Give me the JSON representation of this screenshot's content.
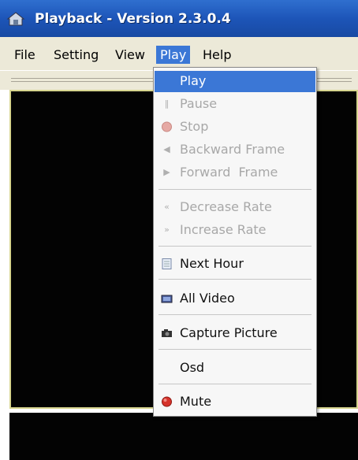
{
  "window": {
    "title": "Playback - Version 2.3.0.4",
    "icon": "app-house-icon"
  },
  "menubar": [
    "File",
    "Setting",
    "View",
    "Play",
    "Help"
  ],
  "play_menu": {
    "items": [
      {
        "label": "Play",
        "state": "highlighted",
        "icon": "none"
      },
      {
        "label": "Pause",
        "state": "disabled",
        "icon": "pause-icon"
      },
      {
        "label": "Stop",
        "state": "disabled",
        "icon": "stop-icon"
      },
      {
        "label": "Backward Frame",
        "state": "disabled",
        "icon": "backward-frame-icon"
      },
      {
        "label": "Forward  Frame",
        "state": "disabled",
        "icon": "forward-frame-icon"
      },
      {
        "label": "Decrease Rate",
        "state": "disabled",
        "icon": "decrease-rate-icon"
      },
      {
        "label": "Increase Rate",
        "state": "disabled",
        "icon": "increase-rate-icon"
      },
      {
        "label": "Next Hour",
        "state": "enabled",
        "icon": "document-icon"
      },
      {
        "label": "All Video",
        "state": "enabled",
        "icon": "video-icon"
      },
      {
        "label": "Capture Picture",
        "state": "enabled",
        "icon": "camera-icon"
      },
      {
        "label": "Osd",
        "state": "enabled",
        "icon": "none"
      },
      {
        "label": "Mute",
        "state": "enabled",
        "icon": "mute-icon"
      }
    ]
  },
  "colors": {
    "titlebar": "#1d55b8",
    "highlight": "#3b77d6",
    "video_bg": "#030303",
    "video_border": "#d7d58f"
  }
}
